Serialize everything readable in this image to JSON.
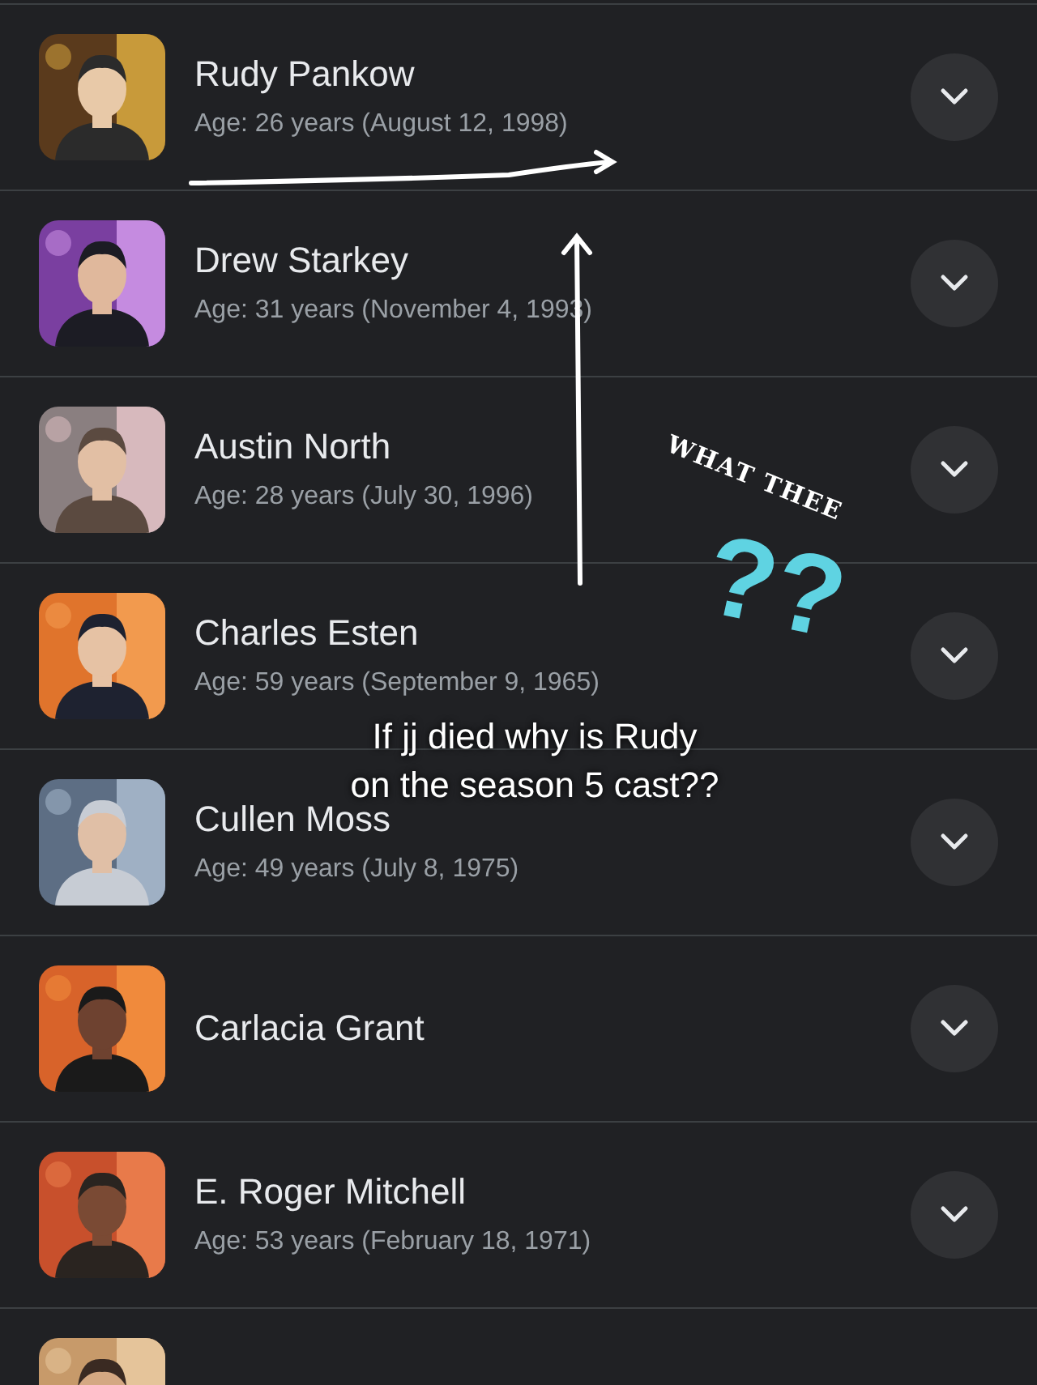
{
  "cast": [
    {
      "name": "Rudy Pankow",
      "age": "Age: 26 years (August 12, 1998)",
      "expanded": false
    },
    {
      "name": "Drew Starkey",
      "age": "Age: 31 years (November 4, 1993)",
      "expanded": false
    },
    {
      "name": "Austin North",
      "age": "Age: 28 years (July 30, 1996)",
      "expanded": false
    },
    {
      "name": "Charles Esten",
      "age": "Age: 59 years (September 9, 1965)",
      "expanded": false
    },
    {
      "name": "Cullen Moss",
      "age": "Age: 49 years (July 8, 1975)",
      "expanded": false
    },
    {
      "name": "Carlacia Grant",
      "expanded": false
    },
    {
      "name": "E. Roger Mitchell",
      "age": "Age: 53 years (February 18, 1971)",
      "expanded": false
    }
  ],
  "annotations": {
    "note": "WHAT THEE",
    "marks": "??",
    "caption": [
      "If jj died why is Rudy",
      "on the season 5 cast??"
    ]
  }
}
